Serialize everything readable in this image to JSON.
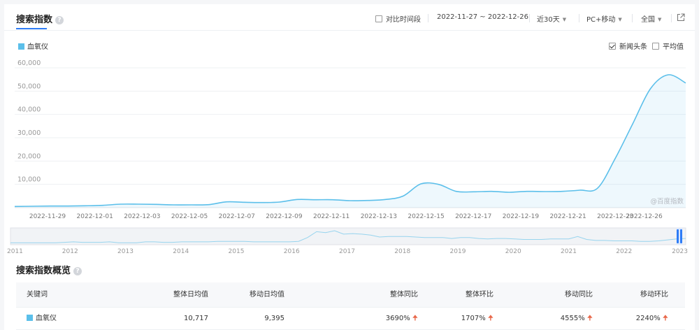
{
  "header": {
    "title": "搜索指数",
    "compare_label": "对比时间段",
    "date_range": "2022-11-27 ~ 2022-12-26",
    "period": "近30天",
    "device": "PC+移动",
    "region": "全国"
  },
  "legend": {
    "series_label": "血氧仪",
    "news_label": "新闻头条",
    "avg_label": "平均值",
    "watermark": "@百度指数"
  },
  "colors": {
    "series": "#5bbfea",
    "accent": "#2e7cf6",
    "up_arrow": "#e8684a"
  },
  "chart_data": {
    "type": "area",
    "series": [
      {
        "name": "血氧仪",
        "values": [
          500,
          600,
          700,
          700,
          800,
          1000,
          1500,
          1500,
          1400,
          1200,
          1200,
          1300,
          2500,
          2300,
          2200,
          2400,
          3500,
          3400,
          3400,
          3000,
          3100,
          3500,
          5000,
          10200,
          10000,
          7000,
          6800,
          7000,
          6600,
          7000,
          6900,
          7000,
          7500,
          8300,
          21000,
          36000,
          51000,
          57000,
          53500
        ]
      }
    ],
    "x_tick_labels": [
      "2022-11-29",
      "2022-12-01",
      "2022-12-03",
      "2022-12-05",
      "2022-12-07",
      "2022-12-09",
      "2022-12-11",
      "2022-12-13",
      "2022-12-15",
      "2022-12-17",
      "2022-12-19",
      "2022-12-21",
      "2022-12-23",
      "2022-12-26"
    ],
    "y_ticks": [
      "60,000",
      "50,000",
      "40,000",
      "30,000",
      "20,000",
      "10,000"
    ],
    "ylim": [
      0,
      60000
    ],
    "grid": true,
    "legend_position": "top-left"
  },
  "timeline": {
    "year_labels": [
      "2011",
      "2012",
      "2013",
      "2014",
      "2015",
      "2016",
      "2017",
      "2018",
      "2019",
      "2020",
      "2021",
      "2022",
      "2023"
    ],
    "overview_values": [
      1,
      1,
      1,
      1,
      1,
      1,
      2,
      3,
      2,
      2,
      2,
      3,
      1,
      1,
      1,
      3,
      3,
      2,
      2,
      3,
      3,
      3,
      3,
      4,
      4,
      4,
      4,
      3,
      3,
      3,
      3,
      3,
      4,
      12,
      24,
      22,
      26,
      19,
      20,
      19,
      17,
      13,
      14,
      14,
      14,
      13,
      12,
      12,
      12,
      10,
      12,
      12,
      10,
      9,
      10,
      10,
      9,
      8,
      8,
      8,
      9,
      9,
      9,
      14,
      8,
      6,
      6,
      5,
      5,
      5,
      4,
      4,
      5,
      7,
      9,
      10
    ]
  },
  "overview": {
    "title": "搜索指数概览",
    "columns": [
      "关键词",
      "整体日均值",
      "移动日均值",
      "整体同比",
      "整体环比",
      "移动同比",
      "移动环比"
    ],
    "row": {
      "keyword": "血氧仪",
      "overall_avg": "10,717",
      "mobile_avg": "9,395",
      "overall_yoy": "3690%",
      "overall_mom": "1707%",
      "mobile_yoy": "4555%",
      "mobile_mom": "2240%"
    }
  }
}
